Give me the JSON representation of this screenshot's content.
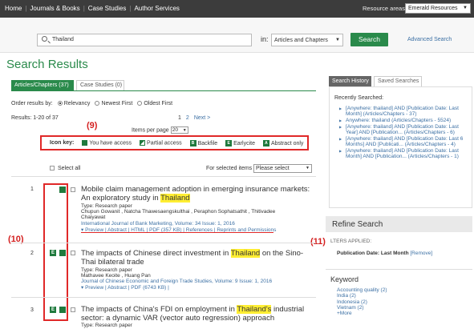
{
  "topnav": {
    "items": [
      "Home",
      "Journals & Books",
      "Case Studies",
      "Author Services"
    ]
  },
  "resource": {
    "label": "Resource areas:",
    "selected": "Emerald Resources"
  },
  "search": {
    "value": "Thailand",
    "in_label": "in:",
    "scope": "Articles and Chapters",
    "button": "Search",
    "advanced": "Advanced Search"
  },
  "page_title": "Search Results",
  "tabs": [
    "Articles/Chapters (37)",
    "Case Studies (0)"
  ],
  "order": {
    "label": "Order results by:",
    "options": [
      "Relevancy",
      "Newest First",
      "Oldest First"
    ]
  },
  "results": {
    "count": "Results: 1-20 of 37",
    "pages": [
      "1",
      "2",
      "Next >"
    ],
    "per_page_label": "Items per page",
    "per_page": "20"
  },
  "annotations": {
    "n9": "(9)",
    "n10": "(10)",
    "n11": "(11)"
  },
  "icon_key": {
    "label": "Icon key:",
    "items": [
      "You have access",
      "Partial access",
      "Backfile",
      "Earlycite",
      "Abstract only"
    ]
  },
  "select": {
    "all": "Select all",
    "for_selected": "For selected items",
    "action": "Please select"
  },
  "items": [
    {
      "num": "1",
      "title_pre": "Mobile claim management adoption in emerging insurance markets: An exploratory study in ",
      "title_hl": "Thailand",
      "title_post": "",
      "type": "Type: Research paper",
      "authors": "Chupun Gowanit , Natcha Thawesaengskulthai , Peraphon Sophatsathit , Thitivadee",
      "authors2": "Chaiyawat",
      "journal": "International Journal of Bank Marketing, Volume: 34 Issue: 1, 2016",
      "links": "▾ Preview | Abstract | HTML | PDF (357 KB) | References | Reprints and Permissions"
    },
    {
      "num": "2",
      "title_pre": "The impacts of Chinese direct investment in ",
      "title_hl": "Thailand",
      "title_post": " on the Sino-Thai bilateral trade",
      "type": "Type: Research paper",
      "authors": "Mathavee Keoite , Huang Pan",
      "journal": "Journal of Chinese Economic and Foreign Trade Studies, Volume: 9 Issue: 1, 2016",
      "links": "▾ Preview | Abstract | PDF (6743 KB) |"
    },
    {
      "num": "3",
      "title_pre": "The impacts of China's FDI on employment in ",
      "title_hl": "Thailand's",
      "title_post": " industrial sector: a dynamic VAR (vector auto regression) approach",
      "type": "Type: Research paper"
    }
  ],
  "sidebar": {
    "tabs": [
      "Search History",
      "Saved Searches"
    ],
    "recent_label": "Recently Searched:",
    "recent": [
      "[Anywhere: thailand] AND [Publication Date: Last Month] (Articles/Chapters - 37)",
      "Anywhere: thailand (Articles/Chapters - 5524)",
      "[Anywhere: thailand] AND [Publication Date: Last Year] AND [Publication... (Articles/Chapters - 6)",
      "[Anywhere: thailand] AND [Publication Date: Last 6 Months] AND [Publicati... (Articles/Chapters - 4)",
      "[Anywhere: thailand] AND [Publication Date: Last Month] AND [Publication... (Articles/Chapters - 1)"
    ],
    "refine": "Refine Search",
    "filters_label": "LTERS APPLIED:",
    "filter_value": "Publication Date: Last Month",
    "filter_remove": "[Remove]",
    "keyword_label": "Keyword",
    "keywords": [
      "Accounting quality (2)",
      "India (2)",
      "Indonesia (2)",
      "Vietnam (2)",
      "+More"
    ]
  }
}
